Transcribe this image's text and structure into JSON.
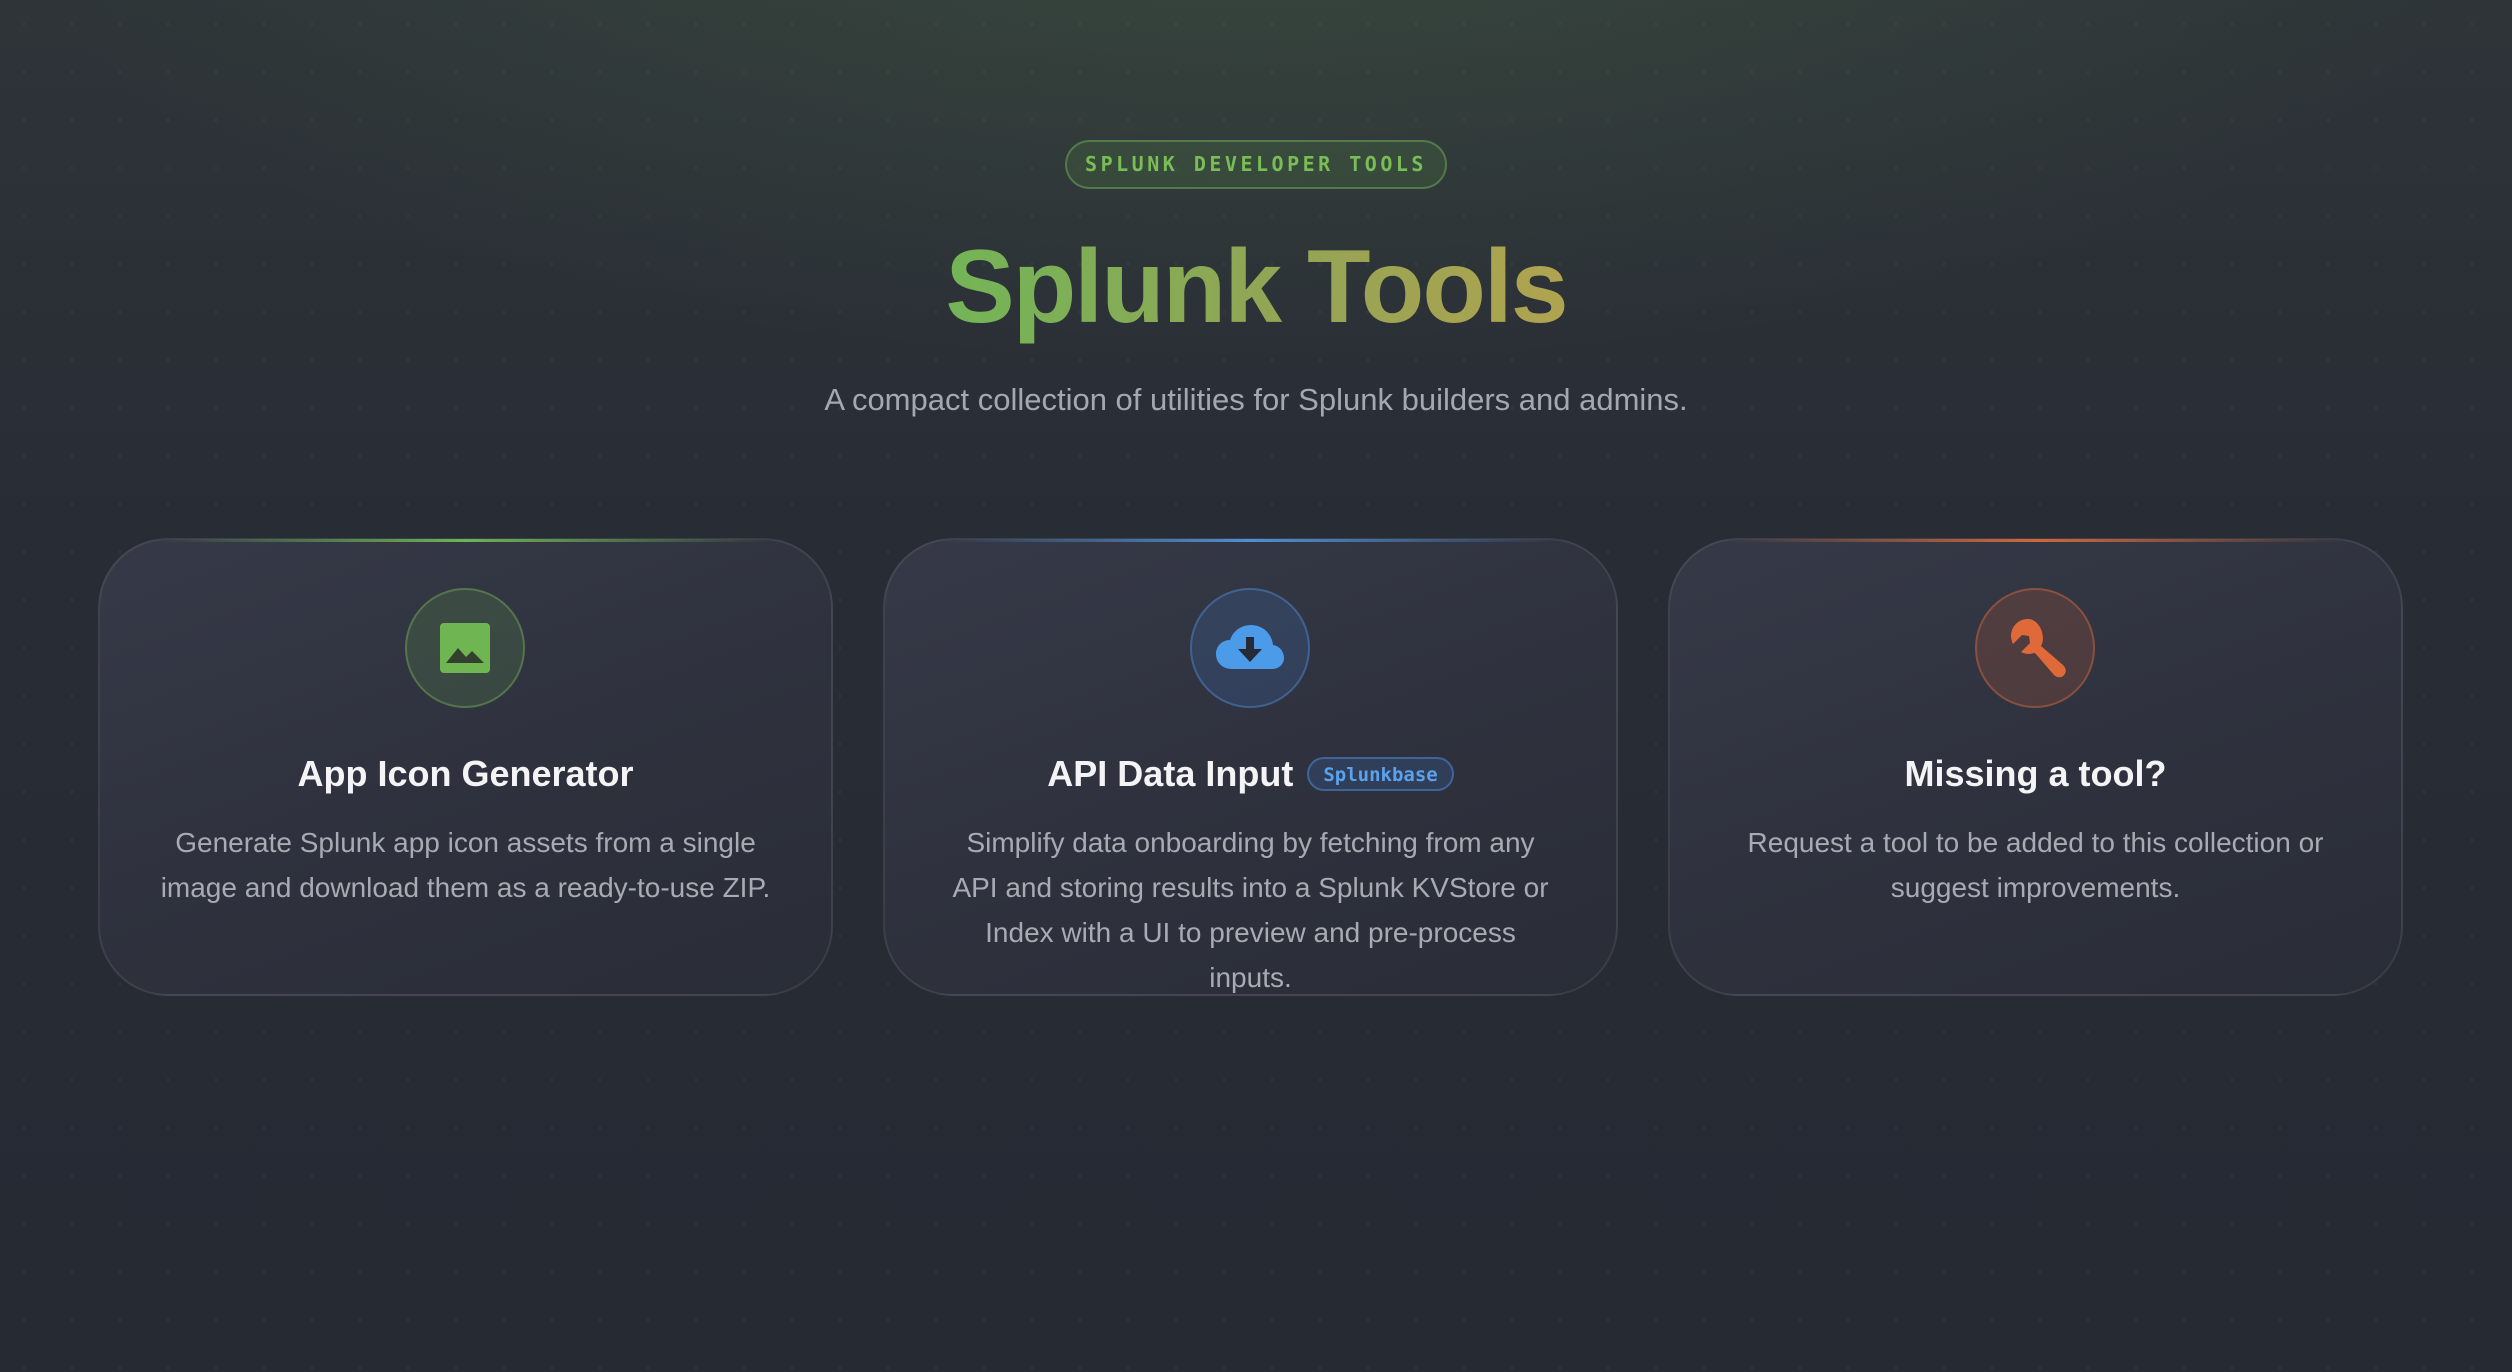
{
  "header": {
    "eyebrow": "SPLUNK DEVELOPER TOOLS",
    "title": "Splunk Tools",
    "subtitle": "A compact collection of utilities for Splunk builders and admins."
  },
  "cards": [
    {
      "title": "App Icon Generator",
      "description": "Generate Splunk app icon assets from a single image and download them as a ready-to-use ZIP.",
      "icon": "image-icon",
      "accent": "#6cb352"
    },
    {
      "title": "API Data Input",
      "badge": "Splunkbase",
      "description": "Simplify data onboarding by fetching from any API and storing results into a Splunk KVStore or Index with a UI to preview and pre-process inputs.",
      "icon": "cloud-download-icon",
      "accent": "#4d8fd6"
    },
    {
      "title": "Missing a tool?",
      "description": "Request a tool to be added to this collection or suggest improvements.",
      "icon": "wrench-icon",
      "accent": "#d0673a"
    }
  ]
}
